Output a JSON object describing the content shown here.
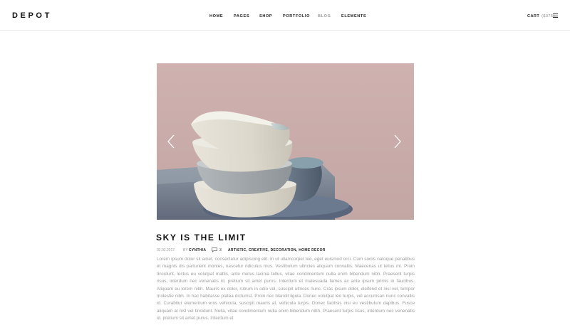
{
  "header": {
    "logo": "DEPOT",
    "nav": [
      {
        "label": "HOME"
      },
      {
        "label": "PAGES"
      },
      {
        "label": "SHOP"
      },
      {
        "label": "PORTFOLIO"
      },
      {
        "label": "BLOG"
      },
      {
        "label": "ELEMENTS"
      }
    ],
    "cart_label": "CART",
    "cart_amount": "($375)",
    "menu_icon": "hamburger-menu-icon"
  },
  "slider": {
    "prev_icon": "chevron-left-icon",
    "next_icon": "chevron-right-icon",
    "image_subject": "stacked ceramic bowls on pink background"
  },
  "post": {
    "title": "SKY IS THE LIMIT",
    "date": "02.02.2017.",
    "by_label": "BY",
    "author": "CYNTHIA",
    "comment_icon": "speech-bubble-icon",
    "comments": "3",
    "tags": [
      "ARTISTIC",
      "CREATIVE",
      "DECORATION",
      "HOME DECOR"
    ],
    "tag_separator": ",",
    "excerpt": "Lorem ipsum dolor sit amet, consectetur adipiscing elit. In ut ullamcorper leo, eget euismod orci. Cum sociis natoque penatibus et magnis dis parturient montes, nascetur ridiculus mus. Vestibulum ultricies aliquam convallis. Maecenas ut tellus mi. Proin tincidunt, lectus eu volutpat mattis, ante metus lacinia tellus, vitae condimentum nulla enim bibendum nibh. Praesent turpis risus, interdum nec venenatis id, pretium sit amet purus. Interdum et malesuada fames ac ante ipsum primis in faucibus. Aliquam eu lorem nibh. Mauris ex dolor, rutrum in odio vel, suscipit ultrices nunc. Cras ipsum dolor, eleifend et nisl vel, tempor molestie nibh. In hac habitasse platea dictumst. Proin nec blandit ligula. Donec volutpat leo turpis, vel accumsan nunc convallis id. Curabitur elementum eros vehicula, suscipit mauris at, vehicula turpis. Donec facilisis nisi eu vestibulum dapibus. Fusce aliquam at nisl vel tincidunt. Nulla, vitae condimentum nulla enim bibendum nibh. Praesent turpis risus, interdum nec venenatis id, pretium sit amet purus. Interdum et"
  },
  "colors": {
    "background": "#ffffff",
    "text_dark": "#222222",
    "text_muted": "#9c9c9c",
    "nav_active": "#9a9a9a",
    "slider_bg": "#c9acaa"
  }
}
